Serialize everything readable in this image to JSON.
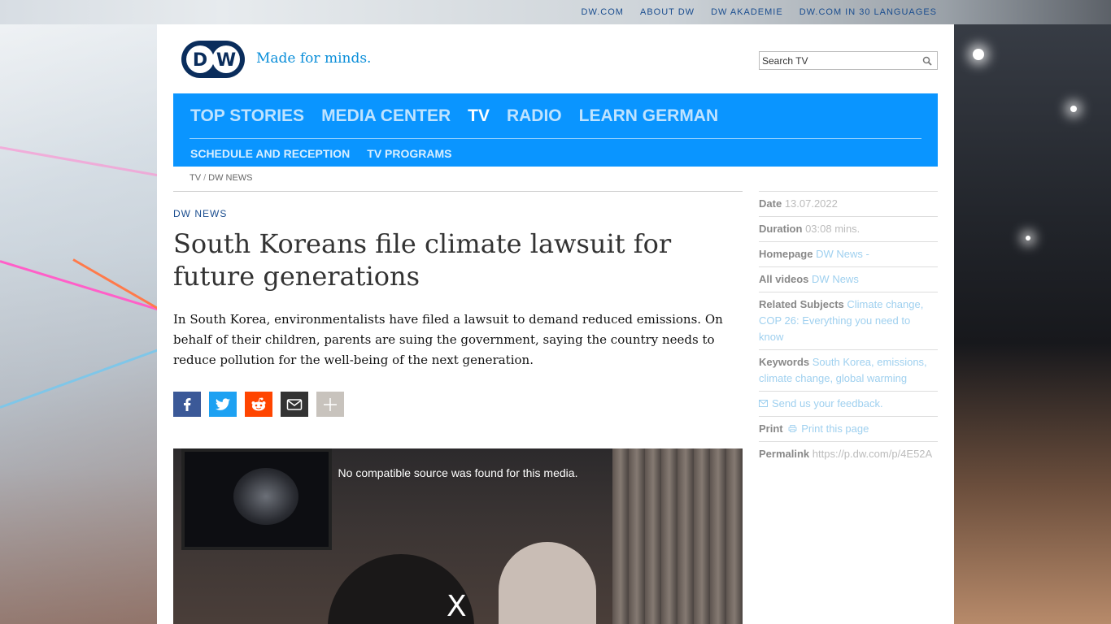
{
  "top_links": [
    "DW.COM",
    "ABOUT DW",
    "DW AKADEMIE",
    "DW.COM IN 30 LANGUAGES"
  ],
  "header": {
    "logo_text": "DW",
    "tagline": "Made for minds.",
    "search_placeholder": "Search TV"
  },
  "nav": {
    "main": [
      {
        "label": "TOP STORIES",
        "active": false
      },
      {
        "label": "MEDIA CENTER",
        "active": false
      },
      {
        "label": "TV",
        "active": true
      },
      {
        "label": "RADIO",
        "active": false
      },
      {
        "label": "LEARN GERMAN",
        "active": false
      }
    ],
    "sub": [
      "SCHEDULE AND RECEPTION",
      "TV PROGRAMS"
    ]
  },
  "breadcrumb": {
    "items": [
      "TV",
      "DW NEWS"
    ],
    "separator": "/"
  },
  "article": {
    "kicker": "DW NEWS",
    "headline": "South Koreans file climate lawsuit for future generations",
    "teaser": "In South Korea, environmentalists have filed a lawsuit to demand reduced emissions. On behalf of their children, parents are suing the government, saying the country needs to reduce pollution for the well-being of the next generation."
  },
  "share": [
    {
      "name": "facebook",
      "color": "#3b5998",
      "icon": "facebook-icon"
    },
    {
      "name": "twitter",
      "color": "#1da1f2",
      "icon": "twitter-icon"
    },
    {
      "name": "reddit",
      "color": "#ff4500",
      "icon": "reddit-icon"
    },
    {
      "name": "email",
      "color": "#333333",
      "icon": "mail-icon"
    },
    {
      "name": "more",
      "color": "#c8c3bd",
      "icon": "plus-icon"
    }
  ],
  "video": {
    "message": "No compatible source was found for this media.",
    "close_label": "X"
  },
  "sidebar": {
    "date": {
      "label": "Date",
      "value": "13.07.2022"
    },
    "duration": {
      "label": "Duration",
      "value": "03:08 mins."
    },
    "homepage": {
      "label": "Homepage",
      "value": "DW News -"
    },
    "all_videos": {
      "label": "All videos",
      "value": "DW News"
    },
    "related": {
      "label": "Related Subjects",
      "value": "Climate change, COP 26: Everything you need to know"
    },
    "keywords": {
      "label": "Keywords",
      "value": "South Korea, emissions, climate change, global warming"
    },
    "feedback": {
      "value": "Send us your feedback."
    },
    "print": {
      "label": "Print",
      "value": "Print this page"
    },
    "permalink": {
      "label": "Permalink",
      "value": "https://p.dw.com/p/4E52A"
    }
  },
  "colors": {
    "nav_bg": "#0a95ff",
    "brand_dark": "#0a2d5c",
    "link_blue": "#1a4d8f",
    "tagline_blue": "#0a8ed9"
  }
}
